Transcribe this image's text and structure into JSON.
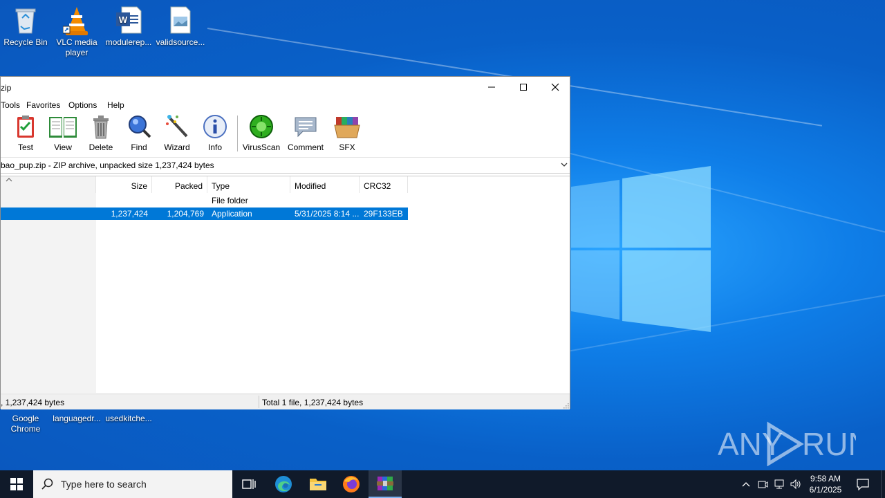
{
  "desktop": {
    "icons": [
      {
        "label": "Recycle Bin"
      },
      {
        "label": "VLC media player"
      },
      {
        "label": "modulerep..."
      },
      {
        "label": "validsource..."
      },
      {
        "label": "Google Chrome"
      },
      {
        "label": "languagedr..."
      },
      {
        "label": "usedkitche..."
      }
    ]
  },
  "window": {
    "title": "zip",
    "menu": [
      "Tools",
      "Favorites",
      "Options",
      "Help"
    ],
    "toolbar": [
      "Test",
      "View",
      "Delete",
      "Find",
      "Wizard",
      "Info",
      "VirusScan",
      "Comment",
      "SFX"
    ],
    "address": "bao_pup.zip - ZIP archive, unpacked size 1,237,424 bytes",
    "columns": [
      "Size",
      "Packed",
      "Type",
      "Modified",
      "CRC32"
    ],
    "rows": [
      {
        "size": "",
        "packed": "",
        "type": "File folder",
        "modified": "",
        "crc": "",
        "selected": false
      },
      {
        "size": "1,237,424",
        "packed": "1,204,769",
        "type": "Application",
        "modified": "5/31/2025 8:14 ...",
        "crc": "29F133EB",
        "selected": true
      }
    ],
    "status_left": ", 1,237,424 bytes",
    "status_right": "Total 1 file, 1,237,424 bytes"
  },
  "taskbar": {
    "search_placeholder": "Type here to search",
    "time": "9:58 AM",
    "date": "6/1/2025"
  },
  "watermark": "ANY RUN",
  "colors": {
    "selection": "#0078d7",
    "taskbar": "#101a2a",
    "desktop": "#0f7ee8"
  }
}
